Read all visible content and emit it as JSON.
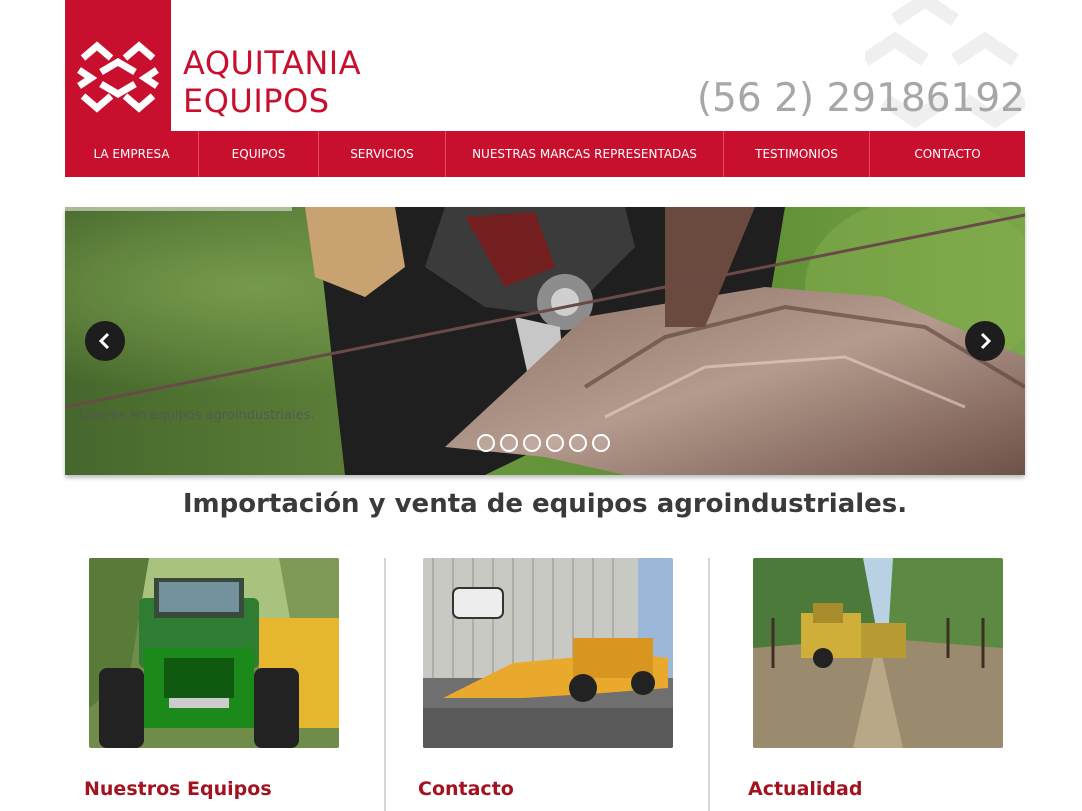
{
  "header": {
    "brand_line1": "AQUITANIA",
    "brand_line2": "EQUIPOS",
    "phone": "(56 2) 29186192",
    "brand_color": "#c8102e"
  },
  "nav": {
    "items": [
      {
        "label": "LA EMPRESA"
      },
      {
        "label": "EQUIPOS"
      },
      {
        "label": "SERVICIOS"
      },
      {
        "label": "NUESTRAS MARCAS REPRESENTADAS"
      },
      {
        "label": "TESTIMONIOS"
      },
      {
        "label": "CONTACTO"
      }
    ]
  },
  "slider": {
    "caption": "Líderes en equipos agroindustriales.",
    "slide_count": 6,
    "prev_icon": "chevron-left-icon",
    "next_icon": "chevron-right-icon"
  },
  "tagline": "Importación y venta de equipos agroindustriales.",
  "cards": [
    {
      "title": "Nuestros Equipos"
    },
    {
      "title": "Contacto"
    },
    {
      "title": "Actualidad"
    }
  ]
}
